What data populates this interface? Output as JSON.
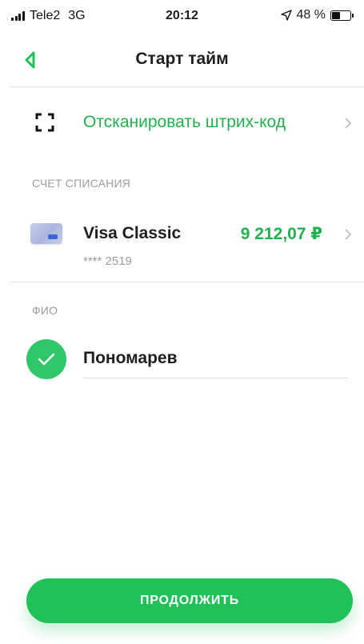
{
  "status_bar": {
    "carrier": "Tele2",
    "network": "3G",
    "time": "20:12",
    "battery_text": "48 %",
    "battery_level": 0.48,
    "icons": [
      "signal-icon",
      "location-arrow-icon",
      "battery-icon"
    ]
  },
  "header": {
    "title": "Старт тайм",
    "back_icon": "chevron-left-icon"
  },
  "scan": {
    "label": "Отсканировать штрих-код",
    "icon": "scan-frame-icon"
  },
  "account_section": {
    "label": "СЧЕТ СПИСАНИЯ",
    "account": {
      "name": "Visa Classic",
      "number": "**** 2519",
      "amount": "9 212,07 ₽",
      "icon": "card-icon"
    }
  },
  "name_section": {
    "label": "ФИО",
    "value": "Пономарев",
    "status_icon": "checkmark-icon"
  },
  "continue_button": {
    "label": "ПРОДОЛЖИТЬ"
  },
  "colors": {
    "accent": "#21b14f",
    "button": "#21c15a",
    "muted_text": "#9d9d9d"
  }
}
